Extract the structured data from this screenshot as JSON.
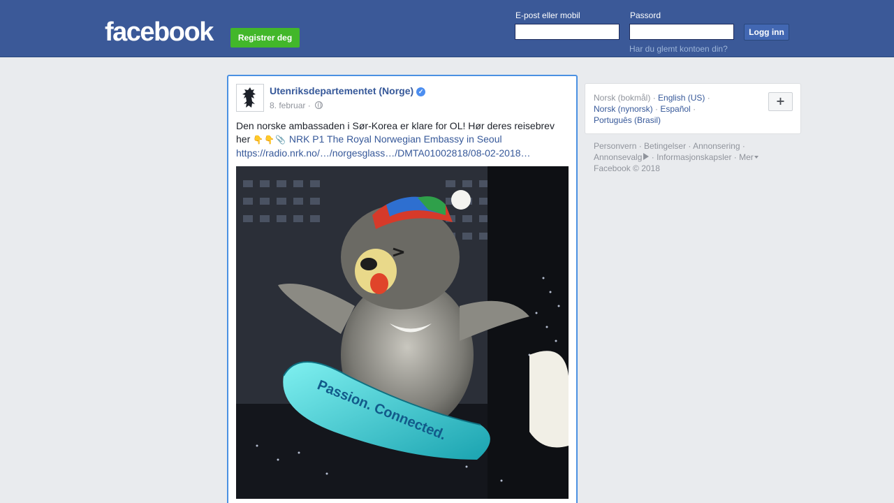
{
  "header": {
    "logo": "facebook",
    "register_label": "Registrer deg",
    "email_label": "E-post eller mobil",
    "email_value": "",
    "password_label": "Passord",
    "password_value": "",
    "login_label": "Logg inn",
    "forgot_label": "Har du glemt kontoen din?"
  },
  "post": {
    "page_name": "Utenriksdepartementet (Norge)",
    "verified_icon": "verified-badge-icon",
    "date": "8. februar · ",
    "privacy_icon": "globe-icon",
    "text": "Den norske ambassaden i Sør-Korea er klare for OL! Hør deres reisebrev her",
    "emojis": "👇👇📎",
    "link_title": "NRK P1 The Royal Norwegian Embassy in Seoul",
    "link_url": "https://radio.nrk.no/…/norgesglass…/DMTA01002818/08-02-2018…",
    "image": {
      "banner_text": "Passion. Connected."
    }
  },
  "languages": {
    "current": "Norsk (bokmål)",
    "items": [
      "English (US)",
      "Norsk (nynorsk)",
      "Español",
      "Português (Brasil)"
    ],
    "add_label": "+"
  },
  "footer": {
    "links": [
      "Personvern",
      "Betingelser",
      "Annonsering",
      "Annonsevalg",
      "Informasjonskapsler",
      "Mer"
    ],
    "copyright": "Facebook © 2018"
  },
  "colors": {
    "brand": "#3b5998",
    "register_green": "#42b72a",
    "link": "#365899",
    "background": "#e9ebee"
  }
}
